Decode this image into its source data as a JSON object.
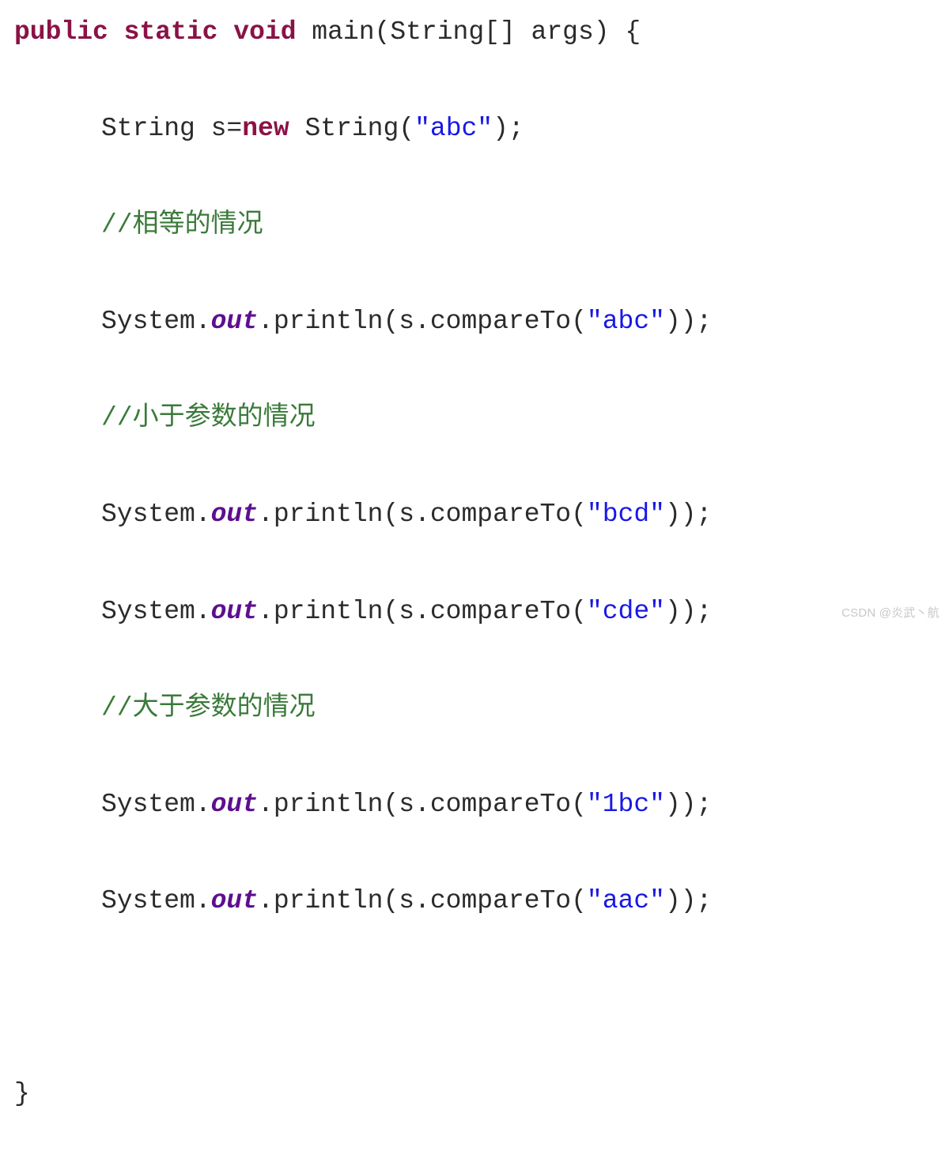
{
  "code": {
    "kw_public": "public",
    "kw_static": "static",
    "kw_void": "void",
    "kw_new": "new",
    "sig_main": " main(String[] args) {",
    "decl_prefix": "String s=",
    "decl_suffix": " String(",
    "decl_close": ");",
    "str_abc": "\"abc\"",
    "comment1": "//相等的情况",
    "sys_prefix": "System.",
    "out_field": "out",
    "println_open": ".println(s.compareTo(",
    "println_close": "));",
    "comment2": "//小于参数的情况",
    "str_bcd": "\"bcd\"",
    "str_cde": "\"cde\"",
    "comment3": "//大于参数的情况",
    "str_1bc": "\"1bc\"",
    "str_aac": "\"aac\"",
    "close_brace": "}"
  },
  "watermark": "CSDN @炎武丶航"
}
